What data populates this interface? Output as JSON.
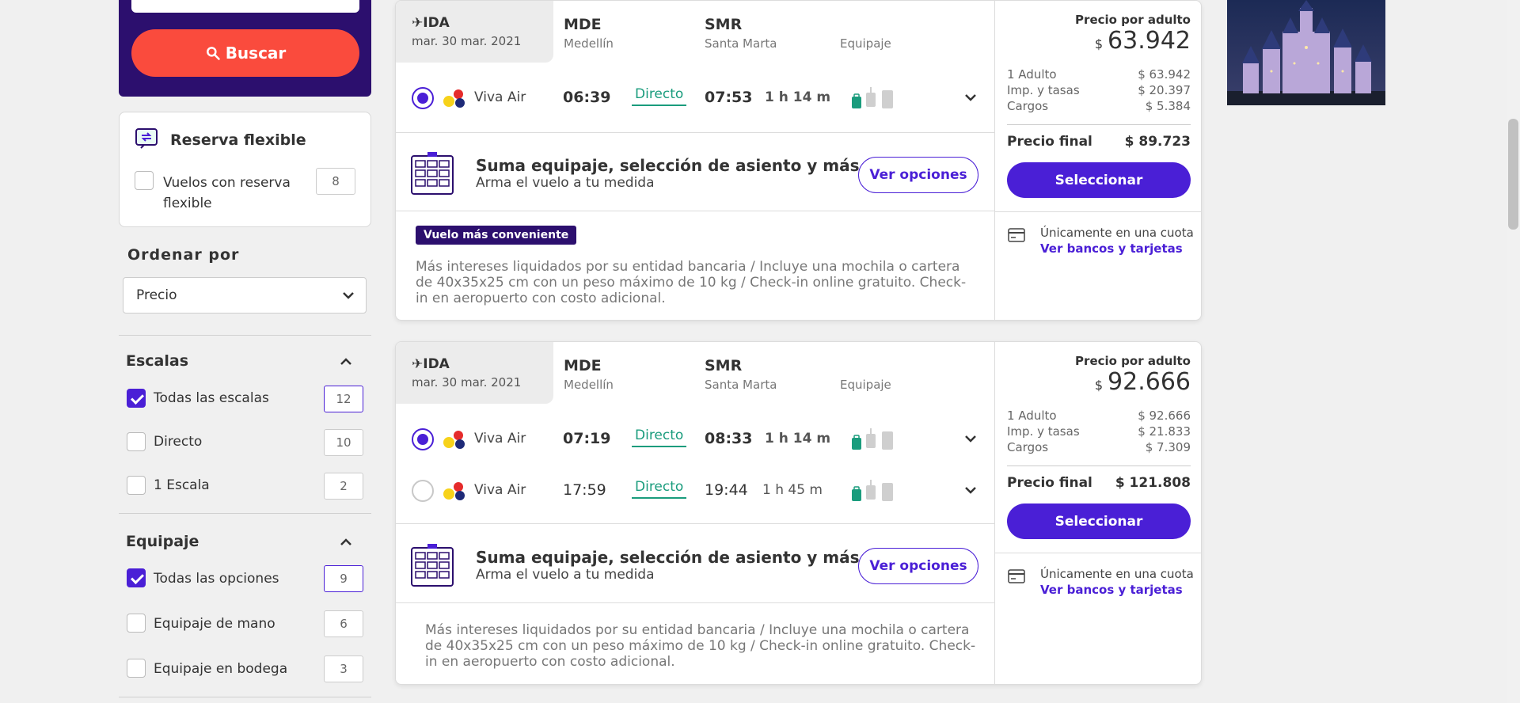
{
  "search": {
    "button_label": "Buscar"
  },
  "flexible": {
    "title": "Reserva flexible",
    "option_label": "Vuelos con reserva flexible",
    "option_count": "8"
  },
  "sort": {
    "title": "Ordenar por",
    "selected": "Precio"
  },
  "stops": {
    "title": "Escalas",
    "options": [
      {
        "label": "Todas las escalas",
        "count": "12",
        "checked": true
      },
      {
        "label": "Directo",
        "count": "10",
        "checked": false
      },
      {
        "label": "1 Escala",
        "count": "2",
        "checked": false
      }
    ]
  },
  "baggage": {
    "title": "Equipaje",
    "options": [
      {
        "label": "Todas las opciones",
        "count": "9",
        "checked": true
      },
      {
        "label": "Equipaje de mano",
        "count": "6",
        "checked": false
      },
      {
        "label": "Equipaje en bodega",
        "count": "3",
        "checked": false
      }
    ]
  },
  "results": [
    {
      "ida_label": "IDA",
      "date": "mar. 30 mar. 2021",
      "origin_code": "MDE",
      "origin_city": "Medellín",
      "dest_code": "SMR",
      "dest_city": "Santa Marta",
      "baggage_header": "Equipaje",
      "flights": [
        {
          "airline": "Viva Air",
          "depart": "06:39",
          "stops": "Directo",
          "arrive": "07:53",
          "duration": "1 h 14 m",
          "selected": true
        }
      ],
      "upsell_title": "Suma equipaje, selección de asiento y más",
      "upsell_sub": "Arma el vuelo a tu medida",
      "upsell_button": "Ver opciones",
      "badge": "Vuelo más conveniente",
      "description": "Más intereses liquidados por su entidad bancaria / Incluye una mochila o cartera de 40x35x25 cm con un peso máximo de 10 kg / Check-in online gratuito. Check-in en aeropuerto con costo adicional.",
      "price_label": "Precio por adulto",
      "currency": "$",
      "price": "63.942",
      "breakdown": [
        {
          "label": "1 Adulto",
          "value": "$ 63.942"
        },
        {
          "label": "Imp. y tasas",
          "value": "$ 20.397"
        },
        {
          "label": "Cargos",
          "value": "$ 5.384"
        }
      ],
      "final_label": "Precio final",
      "final_value": "$ 89.723",
      "select_button": "Seleccionar",
      "cuota_text": "Únicamente en una cuota",
      "bancos_link": "Ver bancos y tarjetas"
    },
    {
      "ida_label": "IDA",
      "date": "mar. 30 mar. 2021",
      "origin_code": "MDE",
      "origin_city": "Medellín",
      "dest_code": "SMR",
      "dest_city": "Santa Marta",
      "baggage_header": "Equipaje",
      "flights": [
        {
          "airline": "Viva Air",
          "depart": "07:19",
          "stops": "Directo",
          "arrive": "08:33",
          "duration": "1 h 14 m",
          "selected": true
        },
        {
          "airline": "Viva Air",
          "depart": "17:59",
          "stops": "Directo",
          "arrive": "19:44",
          "duration": "1 h 45 m",
          "selected": false
        }
      ],
      "upsell_title": "Suma equipaje, selección de asiento y más",
      "upsell_sub": "Arma el vuelo a tu medida",
      "upsell_button": "Ver opciones",
      "description": "Más intereses liquidados por su entidad bancaria / Incluye una mochila o cartera de 40x35x25 cm con un peso máximo de 10 kg / Check-in online gratuito. Check-in en aeropuerto con costo adicional.",
      "price_label": "Precio por adulto",
      "currency": "$",
      "price": "92.666",
      "breakdown": [
        {
          "label": "1 Adulto",
          "value": "$ 92.666"
        },
        {
          "label": "Imp. y tasas",
          "value": "$ 21.833"
        },
        {
          "label": "Cargos",
          "value": "$ 7.309"
        }
      ],
      "final_label": "Precio final",
      "final_value": "$ 121.808",
      "select_button": "Seleccionar",
      "cuota_text": "Únicamente en una cuota",
      "bancos_link": "Ver bancos y tarjetas"
    }
  ],
  "colors": {
    "brand_dark": "#2c0f6e",
    "brand": "#4a1fd6",
    "search_button": "#fa4b3d",
    "direct_green": "#1a9c7d"
  }
}
